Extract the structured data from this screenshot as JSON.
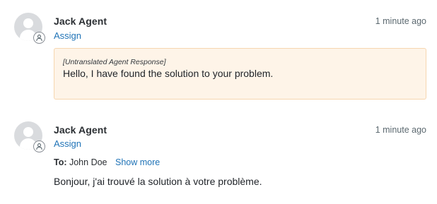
{
  "messages": [
    {
      "author": "Jack Agent",
      "assign_label": "Assign",
      "timestamp": "1 minute ago",
      "untranslated_label": "[Untranslated Agent Response]",
      "text": "Hello, I have found the solution to your problem."
    },
    {
      "author": "Jack Agent",
      "assign_label": "Assign",
      "timestamp": "1 minute ago",
      "to_label": "To:",
      "to_value": "John Doe",
      "show_more_label": "Show more",
      "text": "Bonjour, j'ai trouvé la solution à votre problème."
    }
  ],
  "colors": {
    "link": "#1f73b7",
    "note_background": "#fef4e8",
    "note_border": "#f7d6b0",
    "avatar": "#d9dbde"
  },
  "icons": {
    "avatar": "person-avatar-icon",
    "agent_badge": "agent-person-icon"
  }
}
